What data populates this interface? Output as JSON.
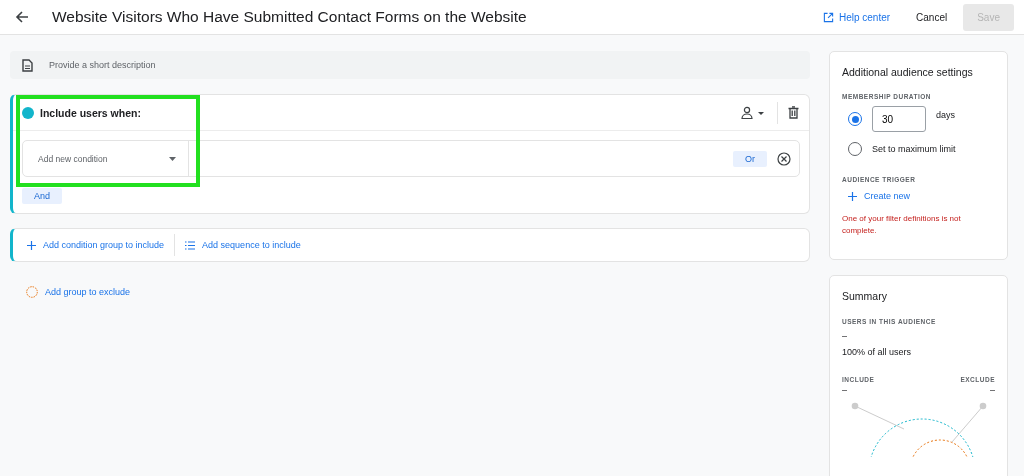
{
  "header": {
    "title": "Website Visitors Who Have Submitted Contact Forms on the Website",
    "help_link": "Help center",
    "cancel": "Cancel",
    "save": {
      "label": "Save",
      "disabled": true
    }
  },
  "description": {
    "placeholder": "Provide a short description"
  },
  "include_group": {
    "title": "Include users when:",
    "condition": {
      "placeholder": "Add new condition"
    },
    "or_button": "Or",
    "and_button": "And"
  },
  "add_actions": [
    {
      "kind": "plus",
      "label": "Add condition group to include"
    },
    {
      "kind": "list",
      "label": "Add sequence to include"
    }
  ],
  "exclude_link": "Add group to exclude",
  "settings": {
    "title": "Additional audience settings",
    "membership_label": "MEMBERSHIP DURATION",
    "options": [
      {
        "kind": "days",
        "value": "30",
        "unit": "days",
        "selected": true
      },
      {
        "kind": "max",
        "label": "Set to maximum limit",
        "selected": false
      }
    ],
    "trigger_label": "AUDIENCE TRIGGER",
    "create_new": "Create new",
    "error": "One of your filter definitions is not complete."
  },
  "summary": {
    "title": "Summary",
    "users_label": "USERS IN THIS AUDIENCE",
    "users_value": "–",
    "share": "100% of all users",
    "include_label": "INCLUDE",
    "include_value": "–",
    "exclude_label": "EXCLUDE",
    "exclude_value": "–"
  }
}
